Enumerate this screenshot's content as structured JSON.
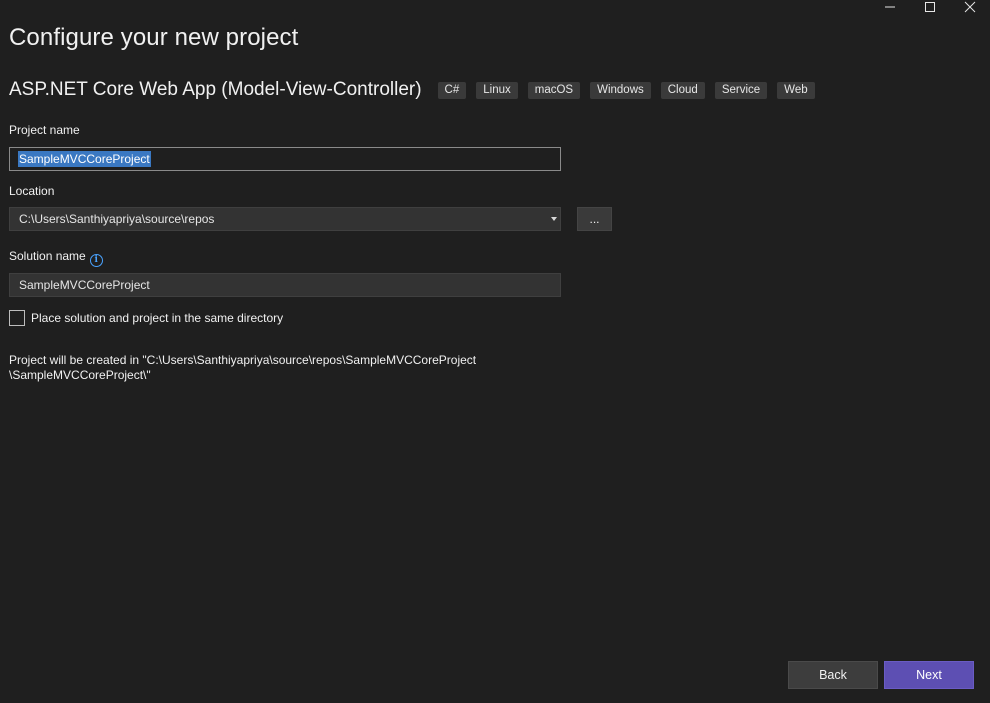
{
  "window": {
    "minimize_label": "",
    "maximize_label": "",
    "close_label": ""
  },
  "page": {
    "title": "Configure your new project"
  },
  "template": {
    "name": "ASP.NET Core Web App (Model-View-Controller)",
    "tags": [
      "C#",
      "Linux",
      "macOS",
      "Windows",
      "Cloud",
      "Service",
      "Web"
    ]
  },
  "project_name": {
    "label": "Project name",
    "value": "SampleMVCCoreProject"
  },
  "location": {
    "label": "Location",
    "value": "C:\\Users\\Santhiyapriya\\source\\repos",
    "browse_label": "..."
  },
  "solution_name": {
    "label": "Solution name",
    "value": "SampleMVCCoreProject",
    "info_icon": "info-icon"
  },
  "same_directory": {
    "label": "Place solution and project in the same directory",
    "checked": false
  },
  "summary": {
    "line1": "Project will be created in \"C:\\Users\\Santhiyapriya\\source\\repos\\SampleMVCCoreProject",
    "line2": "\\SampleMVCCoreProject\\\""
  },
  "footer": {
    "back_label": "Back",
    "next_label": "Next"
  },
  "colors": {
    "background": "#1f1f1f",
    "accent": "#5d4fb3",
    "selection": "#3a78c2",
    "info": "#4aa3ff"
  }
}
